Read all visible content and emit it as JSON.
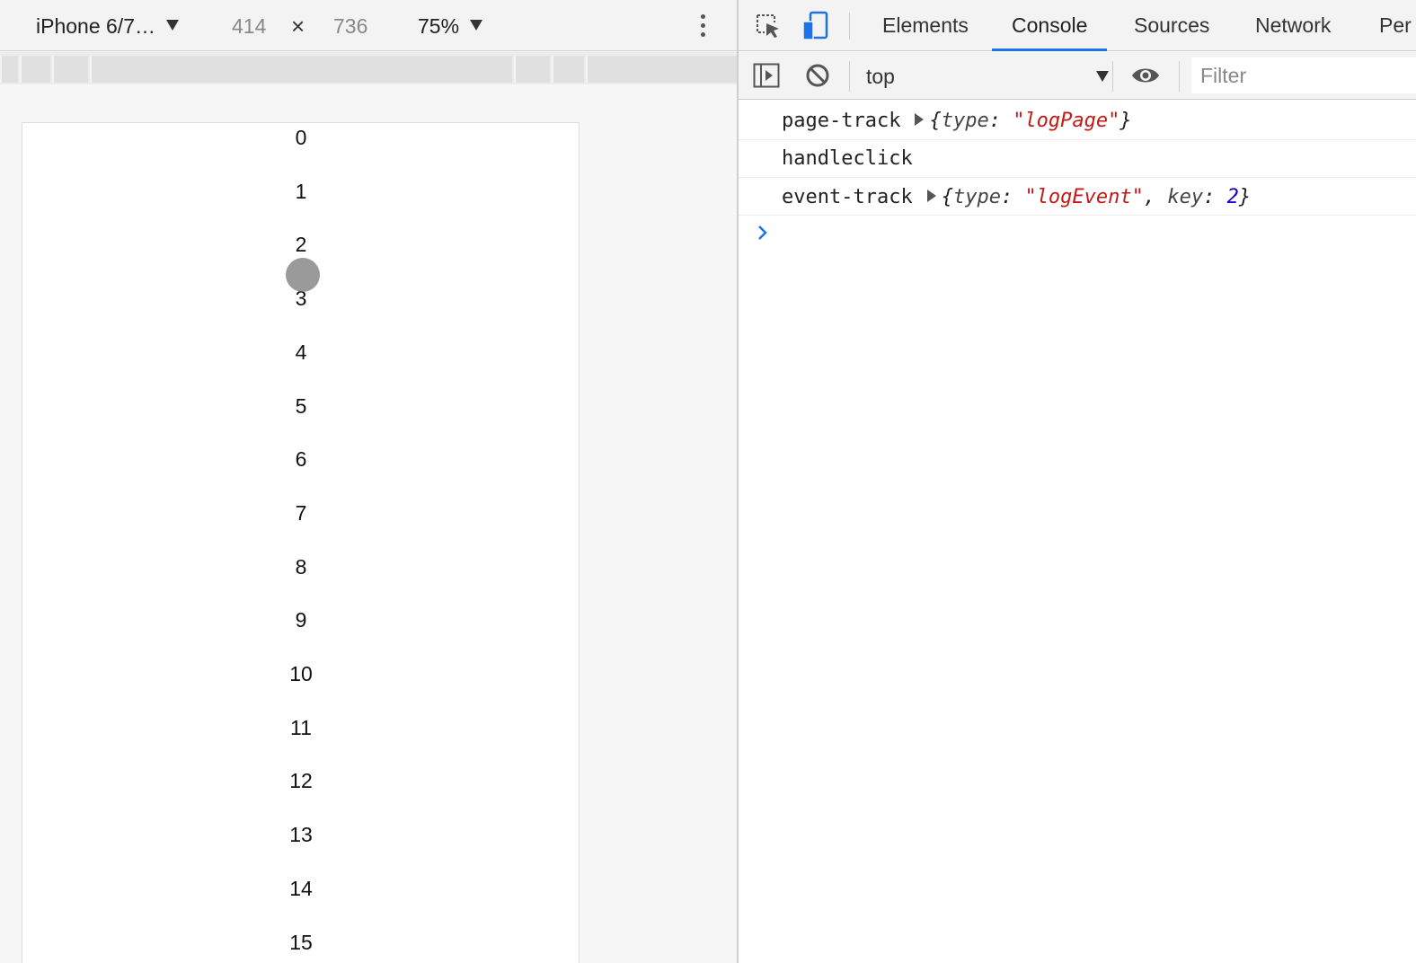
{
  "device_toolbar": {
    "device_name": "iPhone 6/7…",
    "width": "414",
    "times": "×",
    "height": "736",
    "zoom": "75%"
  },
  "page": {
    "items": [
      "0",
      "1",
      "2",
      "3",
      "4",
      "5",
      "6",
      "7",
      "8",
      "9",
      "10",
      "11",
      "12",
      "13",
      "14",
      "15"
    ]
  },
  "devtools": {
    "tabs": [
      {
        "label": "Elements",
        "active": false
      },
      {
        "label": "Console",
        "active": true
      },
      {
        "label": "Sources",
        "active": false
      },
      {
        "label": "Network",
        "active": false
      },
      {
        "label": "Per",
        "active": false
      }
    ],
    "console_toolbar": {
      "context": "top",
      "filter_placeholder": "Filter"
    },
    "messages": [
      {
        "text": "page-track",
        "obj": {
          "open": "{",
          "k1": "type",
          "colon1": ": ",
          "v1": "\"logPage\"",
          "close": "}"
        }
      },
      {
        "text": "handleclick"
      },
      {
        "text": "event-track",
        "obj": {
          "open": "{",
          "k1": "type",
          "colon1": ": ",
          "v1": "\"logEvent\"",
          "sep": ", ",
          "k2": "key",
          "colon2": ": ",
          "v2": "2",
          "close": "}"
        }
      }
    ]
  },
  "colors": {
    "accent": "#1a73e8",
    "string": "#c41a16",
    "number": "#1c00cf",
    "prompt": "#1a73e8"
  }
}
